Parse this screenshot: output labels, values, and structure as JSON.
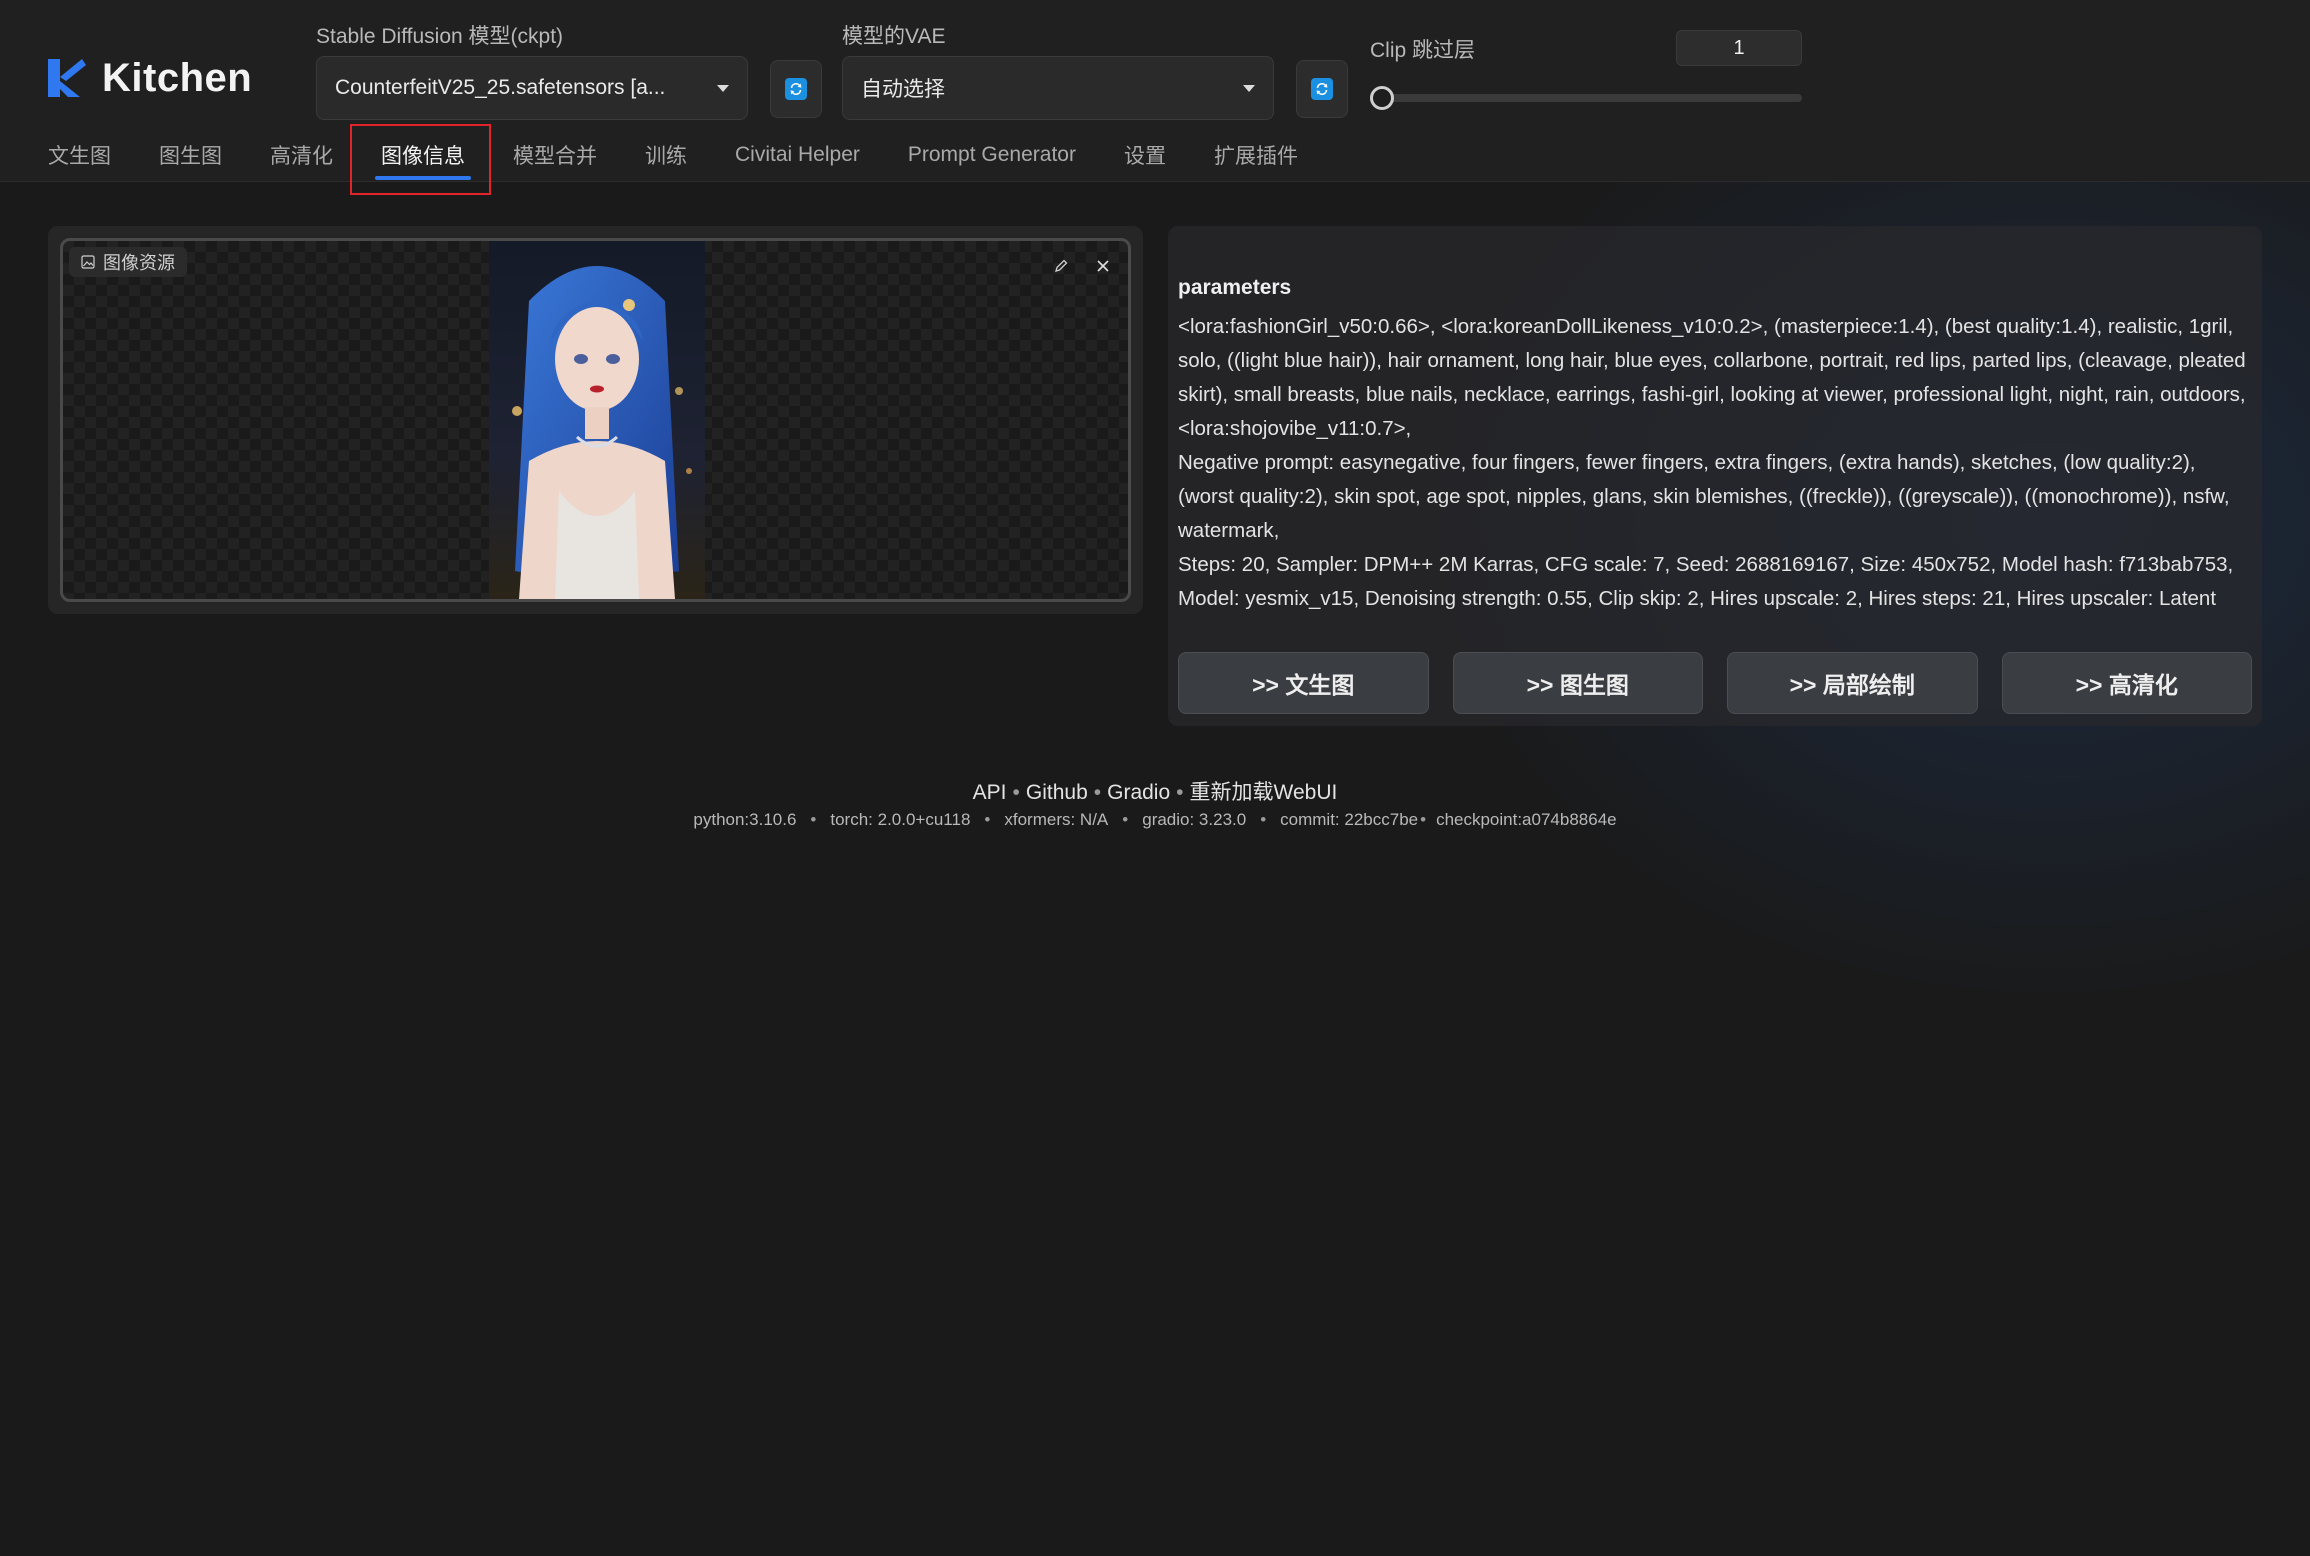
{
  "brand": {
    "name": "Kitchen",
    "accent": "#2f78f0"
  },
  "model_selector": {
    "label": "Stable Diffusion 模型(ckpt)",
    "value": "CounterfeitV25_25.safetensors [a..."
  },
  "vae_selector": {
    "label": "模型的VAE",
    "value": "自动选择"
  },
  "clip_skip": {
    "label": "Clip 跳过层",
    "value": "1"
  },
  "tabs": [
    {
      "label": "文生图"
    },
    {
      "label": "图生图"
    },
    {
      "label": "高清化"
    },
    {
      "label": "图像信息",
      "active": true
    },
    {
      "label": "模型合并"
    },
    {
      "label": "训练"
    },
    {
      "label": "Civitai Helper"
    },
    {
      "label": "Prompt Generator"
    },
    {
      "label": "设置"
    },
    {
      "label": "扩展插件"
    }
  ],
  "image_panel": {
    "label": "图像资源"
  },
  "info_panel": {
    "title": "parameters",
    "prompt": "<lora:fashionGirl_v50:0.66>, <lora:koreanDollLikeness_v10:0.2>, (masterpiece:1.4), (best quality:1.4), realistic, 1gril, solo, ((light blue hair)), hair ornament, long hair, blue eyes, collarbone, portrait, red lips, parted lips, (cleavage, pleated skirt), small breasts, blue nails, necklace, earrings, fashi-girl, looking at viewer, professional light, night, rain, outdoors, <lora:shojovibe_v11:0.7>,",
    "negative_prompt": "Negative prompt: easynegative, four fingers, fewer fingers, extra fingers, (extra hands), sketches, (low quality:2), (worst quality:2), skin spot, age spot, nipples, glans, skin blemishes, ((freckle)), ((greyscale)), ((monochrome)), nsfw, watermark,",
    "settings": "Steps: 20, Sampler: DPM++ 2M Karras, CFG scale: 7, Seed: 2688169167, Size: 450x752, Model hash: f713bab753, Model: yesmix_v15, Denoising strength: 0.55, Clip skip: 2, Hires upscale: 2, Hires steps: 21, Hires upscaler: Latent",
    "send_buttons": [
      ">> 文生图",
      ">> 图生图",
      ">> 局部绘制",
      ">> 高清化"
    ]
  },
  "footer": {
    "links": [
      "API",
      "Github",
      "Gradio",
      "重新加载WebUI"
    ],
    "link_separator": "•",
    "versions": {
      "python": "python:3.10.6",
      "torch": "torch: 2.0.0+cu118",
      "xformers": "xformers: N/A",
      "gradio": "gradio: 3.23.0",
      "commit": "commit: 22bcc7be",
      "checkpoint": "checkpoint:a074b8864e"
    },
    "version_separator": "•"
  },
  "colors": {
    "background": "#1a1a1a",
    "header": "#202020",
    "refresh_icon": "#1b8fe0",
    "highlight": "#e0242a"
  }
}
